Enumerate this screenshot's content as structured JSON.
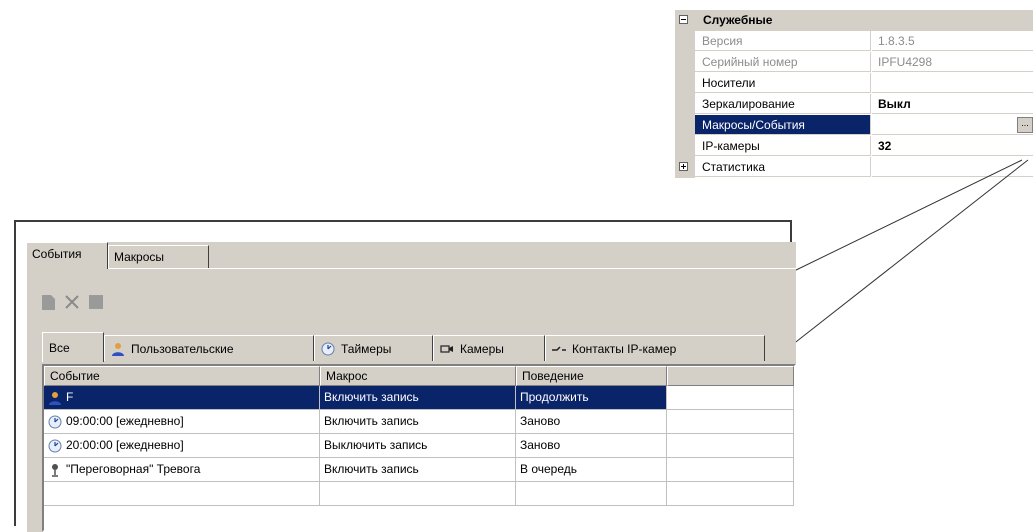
{
  "property_grid": {
    "category_service": "Служебные",
    "rows": [
      {
        "name": "Версия",
        "value": "1.8.3.5"
      },
      {
        "name": "Серийный номер",
        "value": "IPFU4298"
      },
      {
        "name": "Носители",
        "value": ""
      },
      {
        "name": "Зеркалирование",
        "value": "Выкл"
      },
      {
        "name": "Макросы/События",
        "value": ""
      },
      {
        "name": "IP-камеры",
        "value": "32"
      }
    ],
    "category_stats": "Статистика",
    "ellipsis_label": "..."
  },
  "panel": {
    "tabs": [
      "События",
      "Макросы"
    ],
    "toolbar": {
      "new_icon": "document-icon",
      "delete_icon": "delete-x-icon",
      "stop_icon": "square-icon"
    },
    "subtabs": [
      {
        "label": "Все",
        "icon": ""
      },
      {
        "label": "Пользовательские",
        "icon": "user-icon"
      },
      {
        "label": "Таймеры",
        "icon": "clock-icon"
      },
      {
        "label": "Камеры",
        "icon": "camera-icon"
      },
      {
        "label": "Контакты IP-камер",
        "icon": "contact-icon"
      }
    ],
    "grid": {
      "columns": [
        "Событие",
        "Макрос",
        "Поведение"
      ],
      "rows": [
        {
          "event": "F",
          "icon": "user-icon",
          "macro": "Включить запись",
          "behavior": "Продолжить",
          "selected": true
        },
        {
          "event": "09:00:00 [ежедневно]",
          "icon": "clock-icon",
          "macro": "Включить запись",
          "behavior": "Заново",
          "selected": false
        },
        {
          "event": "20:00:00 [ежедневно]",
          "icon": "clock-icon",
          "macro": "Выключить запись",
          "behavior": "Заново",
          "selected": false
        },
        {
          "event": "\"Переговорная\" Тревога",
          "icon": "microphone-icon",
          "macro": "Включить запись",
          "behavior": "В очередь",
          "selected": false
        }
      ]
    }
  },
  "colors": {
    "selection": "#0a246a",
    "face": "#d4d0c8"
  }
}
